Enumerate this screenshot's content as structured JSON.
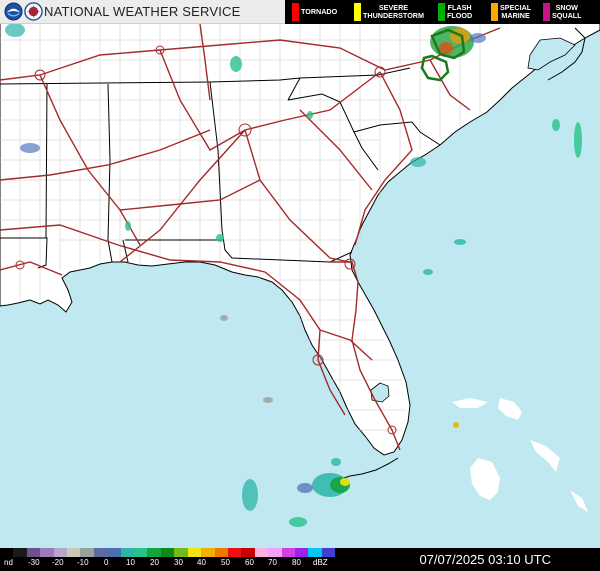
{
  "header": {
    "title": "NATIONAL WEATHER SERVICE",
    "logos": [
      "noaa-logo",
      "nws-logo"
    ]
  },
  "legend": [
    {
      "label": "TORNADO",
      "color": "#ff0000"
    },
    {
      "label": "SEVERE\nTHUNDERSTORM",
      "color": "#ffff00"
    },
    {
      "label": "FLASH\nFLOOD",
      "color": "#00b000"
    },
    {
      "label": "SPECIAL\nMARINE",
      "color": "#ffa500"
    },
    {
      "label": "SNOW\nSQUALL",
      "color": "#c71585"
    }
  ],
  "footer": {
    "timestamp": "07/07/2025 03:10 UTC",
    "scale_labels": [
      "nd",
      "-30",
      "-20",
      "-10",
      "0",
      "10",
      "20",
      "30",
      "40",
      "50",
      "60",
      "70",
      "80",
      "dBZ"
    ],
    "scale_colors": [
      "#000000",
      "#1a1a1a",
      "#6e5090",
      "#9c7cb8",
      "#b7a6c7",
      "#c9c9b5",
      "#9aa09a",
      "#5e6ba0",
      "#4a6fb0",
      "#2cb5a8",
      "#28c28a",
      "#14a33c",
      "#0d8a1a",
      "#6ebd1a",
      "#f2e410",
      "#f0b000",
      "#f07800",
      "#ee1010",
      "#c40000",
      "#ffb0e0",
      "#f5a0f5",
      "#d040e0",
      "#a020f0",
      "#00c8f0",
      "#4040d0"
    ]
  },
  "map": {
    "colors": {
      "water": "#bfe8f0",
      "land": "#ffffff",
      "state_border": "#000000",
      "county_border": "#c8c8c8",
      "highway": "#a52a2a"
    },
    "warning_polygons": [
      "flash-flood-warning-north-carolina"
    ]
  }
}
